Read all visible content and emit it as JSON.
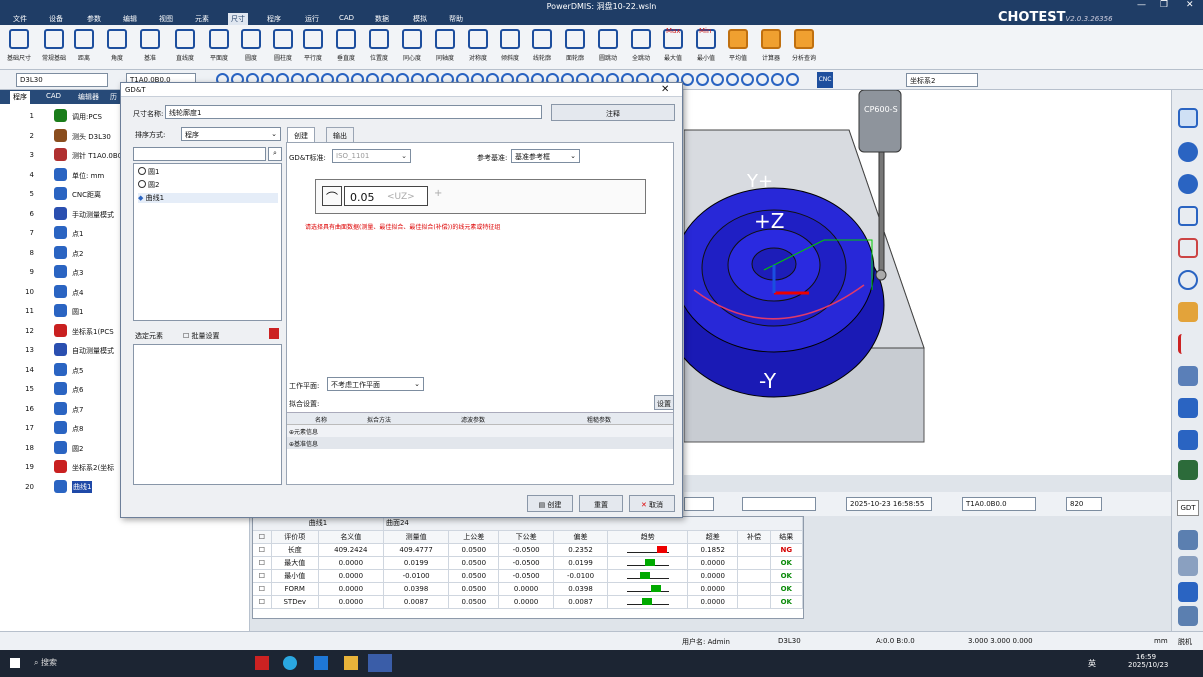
{
  "app": {
    "title": "PowerDMIS: 洞盘10-22.wsln",
    "brand": "CHOTEST",
    "version": "V2.0.3.26356"
  },
  "menu": [
    "文件",
    "设备",
    "参数",
    "编辑",
    "视图",
    "元素",
    "尺寸",
    "程序",
    "运行",
    "CAD",
    "数据",
    "模拟",
    "帮助"
  ],
  "menu_active": "尺寸",
  "ribbon": [
    "基础尺寸",
    "常规基础",
    "距离",
    "角度",
    "基准",
    "直线度",
    "平面度",
    "圆度",
    "圆柱度",
    "平行度",
    "垂直度",
    "位置度",
    "同心度",
    "同轴度",
    "对称度",
    "倾斜度",
    "线轮廓",
    "面轮廓",
    "圆跳动",
    "全跳动",
    "最大值",
    "最小值",
    "平均值",
    "计算器",
    "分析查询"
  ],
  "ribbon_max": "Max",
  "ribbon_min": "Min",
  "toolbar2": {
    "probe_select": "D3L30",
    "probe_select2": "T1A0.0B0.0",
    "coord_select": "坐标系2",
    "cnc_label": "CNC"
  },
  "left_tabs": [
    "程序",
    "CAD",
    "编辑器",
    "历"
  ],
  "program": [
    {
      "num": "1",
      "label": "调用:PCS",
      "color": "#1a7d1a"
    },
    {
      "num": "2",
      "label": "测头 D3L30",
      "color": "#8a4d1e"
    },
    {
      "num": "3",
      "label": "测针 T1A0.0B0",
      "color": "#b03030"
    },
    {
      "num": "4",
      "label": "单位: mm",
      "color": "#2a64c2"
    },
    {
      "num": "5",
      "label": "CNC距离",
      "color": "#2a64c2"
    },
    {
      "num": "6",
      "label": "手动测量模式",
      "color": "#2a4fb0"
    },
    {
      "num": "7",
      "label": "点1",
      "color": "#2a64c2"
    },
    {
      "num": "8",
      "label": "点2",
      "color": "#2a64c2"
    },
    {
      "num": "9",
      "label": "点3",
      "color": "#2a64c2"
    },
    {
      "num": "10",
      "label": "点4",
      "color": "#2a64c2"
    },
    {
      "num": "11",
      "label": "圆1",
      "color": "#2a64c2"
    },
    {
      "num": "12",
      "label": "坐标系1(PCS",
      "color": "#c92020"
    },
    {
      "num": "13",
      "label": "自动测量模式",
      "color": "#2a4fb0"
    },
    {
      "num": "14",
      "label": "点5",
      "color": "#2a64c2"
    },
    {
      "num": "15",
      "label": "点6",
      "color": "#2a64c2"
    },
    {
      "num": "16",
      "label": "点7",
      "color": "#2a64c2"
    },
    {
      "num": "17",
      "label": "点8",
      "color": "#2a64c2"
    },
    {
      "num": "18",
      "label": "圆2",
      "color": "#2a64c2"
    },
    {
      "num": "19",
      "label": "坐标系2(坐标",
      "color": "#c92020"
    },
    {
      "num": "20",
      "label": "曲线1",
      "color": "#2a64c2",
      "selected": true
    }
  ],
  "dialog": {
    "title": "GD&T",
    "name_label": "尺寸名称:",
    "name_value": "线轮廓度1",
    "note_button": "注释",
    "sort_label": "排序方式:",
    "sort_value": "程序",
    "search_value": "",
    "list_items": [
      "圆1",
      "圆2",
      "曲线1"
    ],
    "selected_elements_label": "选定元素",
    "batch_label": "批量设置",
    "tabs": [
      "创建",
      "输出"
    ],
    "gdt_std_label": "GD&T标准:",
    "gdt_std_value": "ISO_1101",
    "ref_label": "参考基准:",
    "ref_value": "基准参考框",
    "frame_symbol": "⌒",
    "frame_tolerance": "0.05",
    "frame_uz": "<UZ>",
    "frame_plus": "+",
    "hint": "请选择具有曲面数据(测量、最佳拟合、最佳拟合(补偿))的线元素或特征组",
    "work_plane_label": "工作平面:",
    "work_plane_value": "不考虑工作平面",
    "fit_label": "拟合设置:",
    "fit_button": "设置",
    "fit_headers": [
      "名称",
      "拟合方法",
      "滤波参数",
      "粗糙参数"
    ],
    "fit_rows": [
      "元素信息",
      "基准信息"
    ],
    "create_button": "创建",
    "reset_button": "重置",
    "cancel_button": "取消"
  },
  "viewport": {
    "probe_label": "CP600-S",
    "axis_y_plus": "Y+",
    "axis_z_plus": "+Z",
    "axis_y_minus": "-Y"
  },
  "bottombar": {
    "datetime": "2025-10-23 16:58:55",
    "tip": "T1A0.0B0.0",
    "speed": "820"
  },
  "result": {
    "header": [
      "曲线1",
      "曲面24"
    ],
    "columns": [
      "",
      "评价项",
      "名义值",
      "测量值",
      "上公差",
      "下公差",
      "偏差",
      "趋势",
      "超差",
      "补偿",
      "结果"
    ],
    "rows": [
      {
        "item": "长度",
        "nominal": "409.2424",
        "measured": "409.4777",
        "upper": "0.0500",
        "lower": "-0.0500",
        "dev": "0.2352",
        "trend": 1.0,
        "over": "0.1852",
        "comp": "",
        "result": "NG"
      },
      {
        "item": "最大值",
        "nominal": "0.0000",
        "measured": "0.0199",
        "upper": "0.0500",
        "lower": "-0.0500",
        "dev": "0.0199",
        "trend": 0.6,
        "over": "0.0000",
        "comp": "",
        "result": "OK"
      },
      {
        "item": "最小值",
        "nominal": "0.0000",
        "measured": "-0.0100",
        "upper": "0.0500",
        "lower": "-0.0500",
        "dev": "-0.0100",
        "trend": 0.45,
        "over": "0.0000",
        "comp": "",
        "result": "OK"
      },
      {
        "item": "FORM",
        "nominal": "0.0000",
        "measured": "0.0398",
        "upper": "0.0500",
        "lower": "0.0000",
        "dev": "0.0398",
        "trend": 0.8,
        "over": "0.0000",
        "comp": "",
        "result": "OK"
      },
      {
        "item": "STDev",
        "nominal": "0.0000",
        "measured": "0.0087",
        "upper": "0.0500",
        "lower": "0.0000",
        "dev": "0.0087",
        "trend": 0.5,
        "over": "0.0000",
        "comp": "",
        "result": "OK"
      }
    ]
  },
  "status": {
    "user": "用户名: Admin",
    "probe": "D3L30",
    "angles": "A:0.0  B:0.0",
    "xyz": "3.000  3.000  0.000",
    "unit": "mm",
    "mode": "脱机"
  },
  "taskbar": {
    "search": "搜索",
    "time": "16:59",
    "date": "2025/10/23",
    "lang": "英"
  },
  "right_tools": [
    "GDT"
  ]
}
